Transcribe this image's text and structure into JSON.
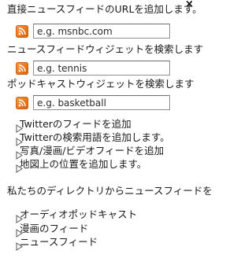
{
  "close_label": "×",
  "rss_url": {
    "prompt": "直接ニュースフィードのURLを追加します。",
    "placeholder": "e.g. msnbc.com",
    "icon": "rss-icon"
  },
  "news_widget": {
    "prompt": "ニュースフィードウィジェットを検索します",
    "placeholder": "e.g. tennis",
    "icon": "rss-icon"
  },
  "podcast_widget": {
    "prompt": "ポッドキャストウィジェットを検索します",
    "placeholder": "e.g. basketball",
    "icon": "rss-icon"
  },
  "quick_links": [
    "Twitterのフィードを追加",
    "Twitterの検索用語を追加します。",
    "写真/漫画/ビデオフィードを追加",
    "地図上の位置を追加します。"
  ],
  "directory": {
    "heading": "私たちのディレクトリからニュースフィードを",
    "links": [
      "オーディオポッドキャスト",
      "漫画のフィード",
      "ニュースフィード"
    ]
  },
  "colors": {
    "rss_orange": "#e8771d"
  }
}
